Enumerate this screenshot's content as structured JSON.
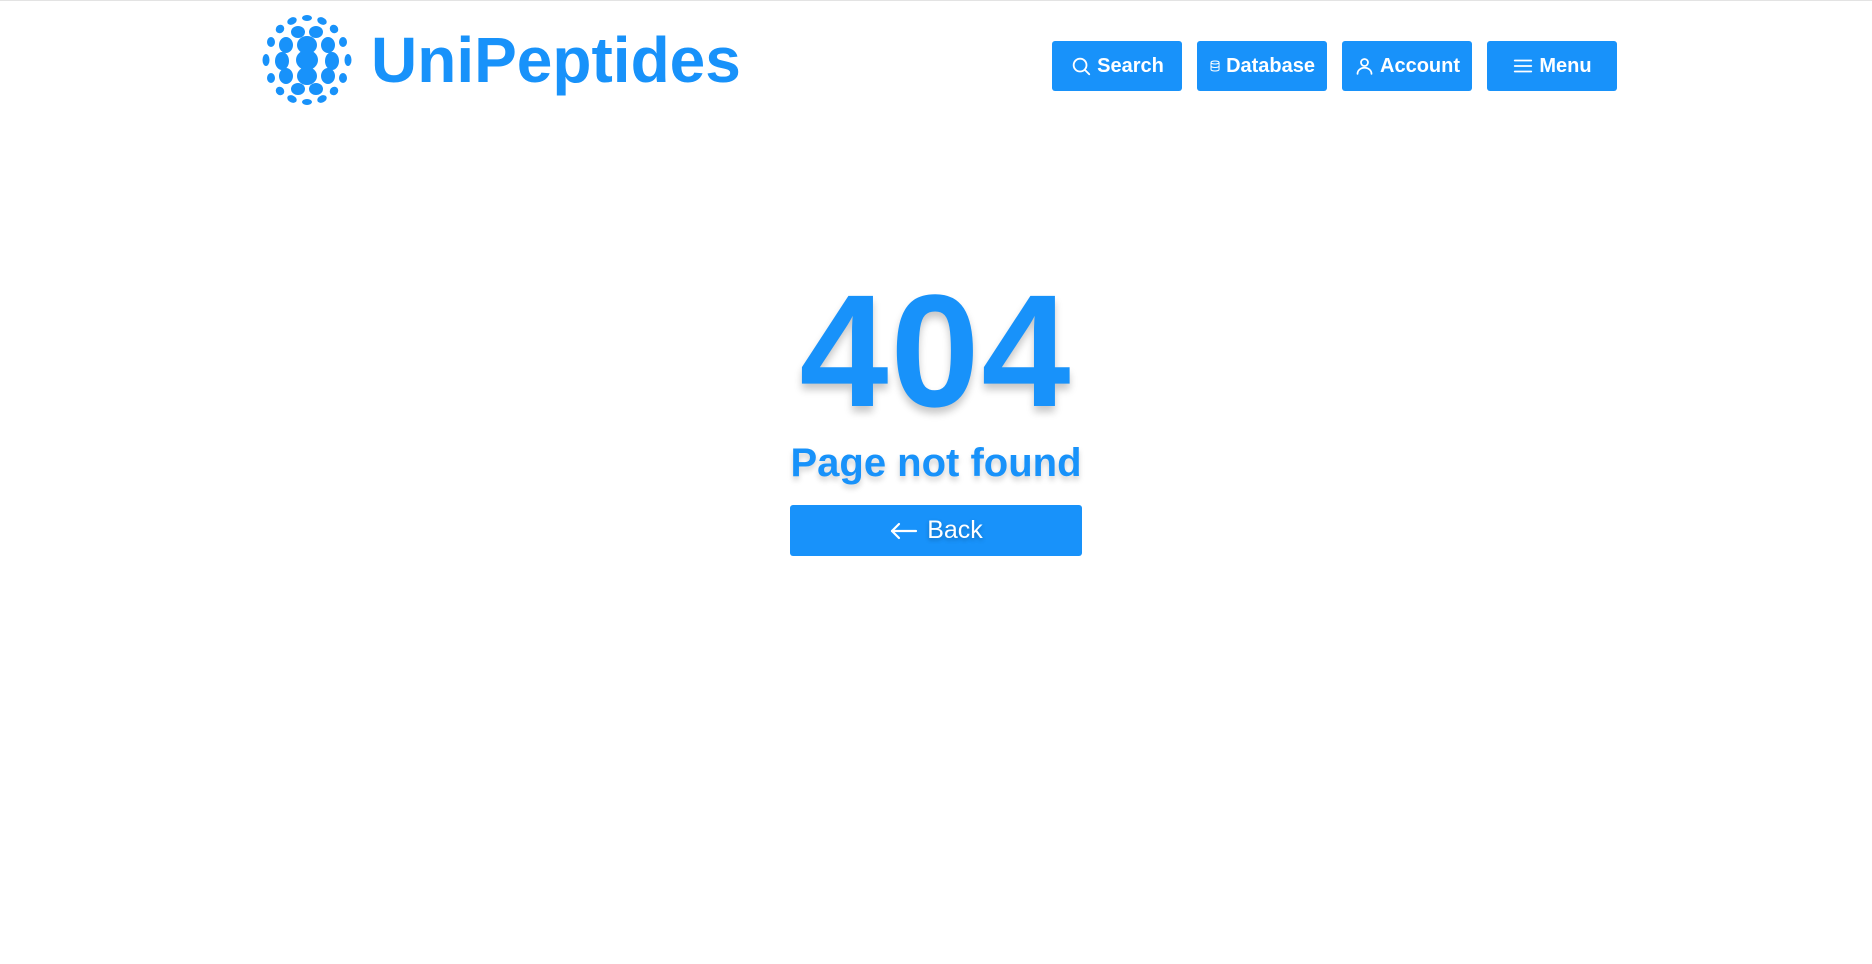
{
  "brand": {
    "name": "UniPeptides",
    "color": "#1892fa"
  },
  "nav": {
    "search": {
      "label": "Search",
      "icon": "search-icon"
    },
    "database": {
      "label": "Database",
      "icon": "database-icon"
    },
    "account": {
      "label": "Account",
      "icon": "user-icon"
    },
    "menu": {
      "label": "Menu",
      "icon": "hamburger-icon"
    }
  },
  "error": {
    "code": "404",
    "message": "Page not found",
    "back_label": "Back",
    "back_icon": "arrow-left-icon"
  }
}
